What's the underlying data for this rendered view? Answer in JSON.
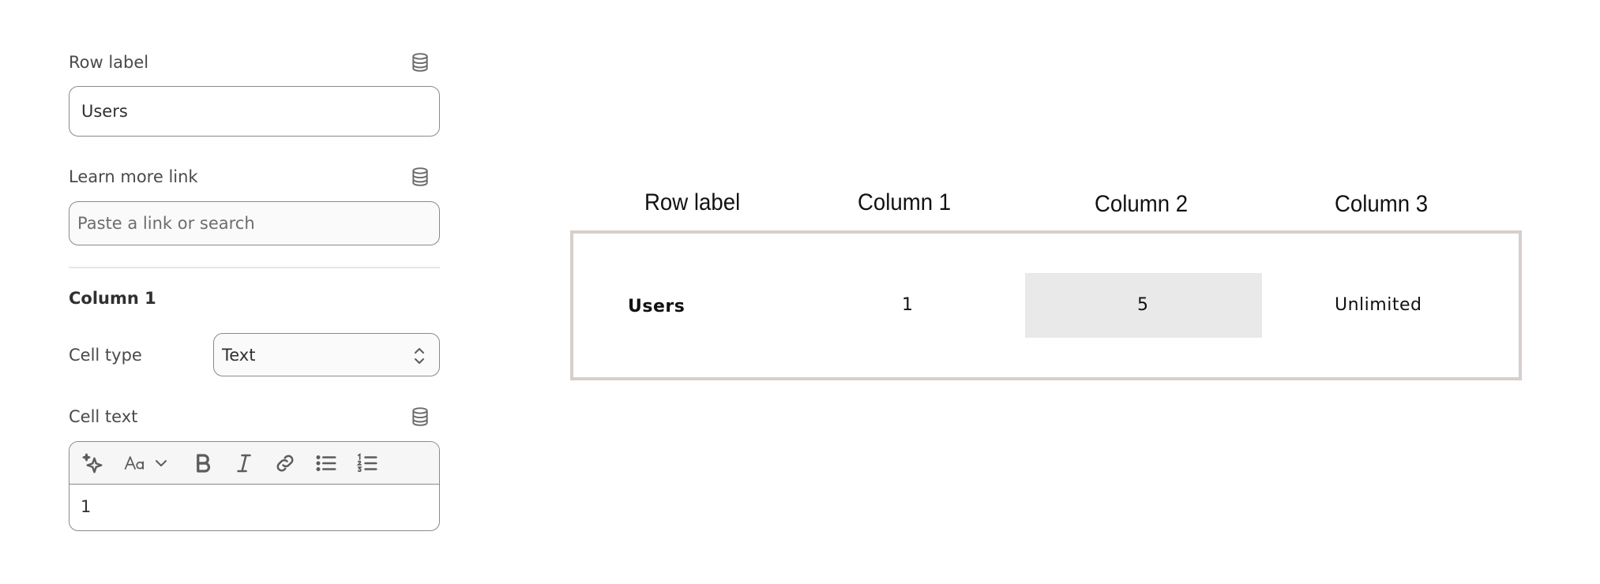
{
  "settings": {
    "row_label": {
      "label": "Row label",
      "value": "Users",
      "icon": "database-icon"
    },
    "learn_more": {
      "label": "Learn more link",
      "placeholder": "Paste a link or search",
      "icon": "database-icon"
    },
    "column_section": {
      "title": "Column 1",
      "cell_type": {
        "label": "Cell type",
        "value": "Text"
      },
      "cell_text": {
        "label": "Cell text",
        "icon": "database-icon",
        "toolbar": [
          "magic-sparkle-icon",
          "font-size-icon",
          "chevron-down-icon",
          "bold-icon",
          "italic-icon",
          "link-icon",
          "bullet-list-icon",
          "numbered-list-icon"
        ],
        "value": "1"
      }
    }
  },
  "preview": {
    "headers": [
      "Row label",
      "Column 1",
      "Column 2",
      "Column 3"
    ],
    "row": {
      "label": "Users",
      "cells": [
        "1",
        "5",
        "Unlimited"
      ]
    },
    "colors": {
      "table_border": "#d6cfcb",
      "highlight_cell": "#e9e9e9"
    }
  }
}
